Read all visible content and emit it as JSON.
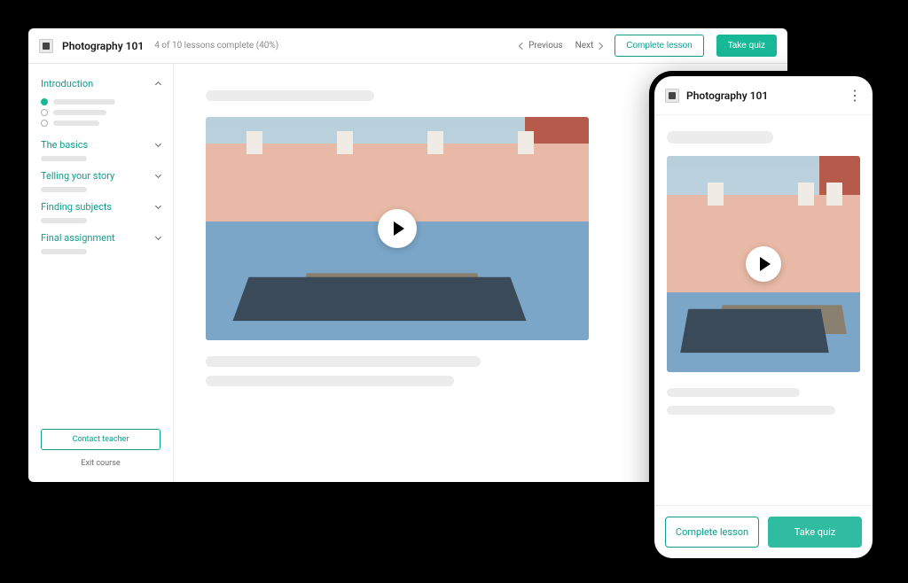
{
  "course": {
    "title": "Photography 101",
    "progress_label": "4 of 10 lessons complete (40%)"
  },
  "nav": {
    "previous": "Previous",
    "next": "Next",
    "complete_lesson": "Complete lesson",
    "take_quiz": "Take quiz"
  },
  "sections": {
    "introduction": "Introduction",
    "basics": "The basics",
    "story": "Telling your story",
    "subjects": "Finding subjects",
    "final": "Final assignment"
  },
  "sidebar_actions": {
    "contact": "Contact teacher",
    "exit": "Exit course"
  },
  "mobile": {
    "title": "Photography 101",
    "complete_lesson": "Complete lesson",
    "take_quiz": "Take quiz"
  },
  "colors": {
    "accent": "#17b897",
    "accent_text": "#0b9e8e"
  }
}
